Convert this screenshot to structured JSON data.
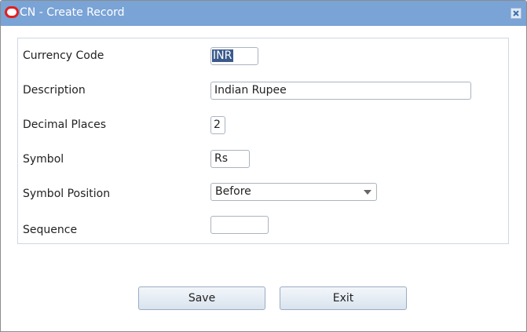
{
  "window": {
    "title": "CN - Create Record",
    "close_icon": "close-icon",
    "logo_icon": "oracle-logo-icon"
  },
  "form": {
    "currency_code": {
      "label": "Currency Code",
      "value": "INR"
    },
    "description": {
      "label": "Description",
      "value": "Indian Rupee"
    },
    "decimal_places": {
      "label": "Decimal Places",
      "value": "2"
    },
    "symbol": {
      "label": "Symbol",
      "value": "Rs"
    },
    "symbol_position": {
      "label": "Symbol Position",
      "value": "Before",
      "icon": "chevron-down-icon"
    },
    "sequence": {
      "label": "Sequence",
      "value": ""
    }
  },
  "buttons": {
    "save_label": "Save",
    "exit_label": "Exit"
  },
  "colors": {
    "titlebar": "#7aa3d6",
    "selection": "#3a5a8c"
  }
}
